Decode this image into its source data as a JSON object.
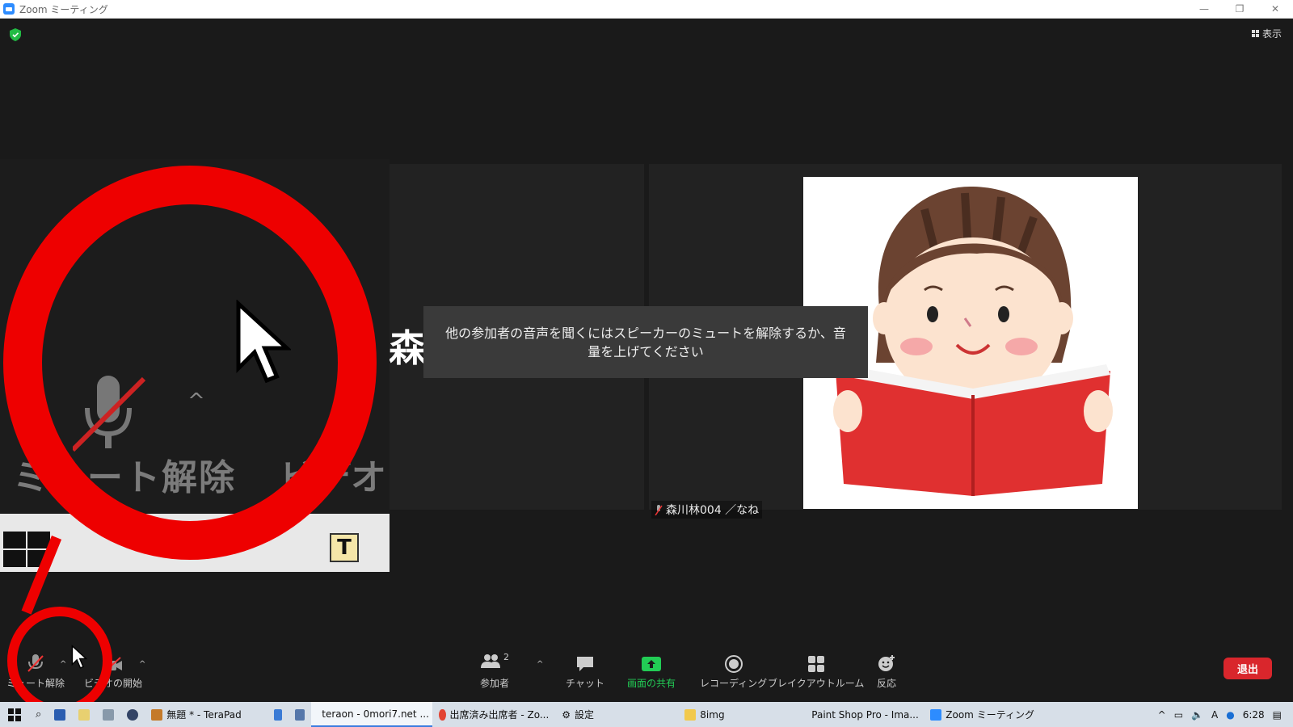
{
  "window": {
    "title": "Zoom ミーティング",
    "controls": [
      "—",
      "❐",
      "✕"
    ]
  },
  "meeting": {
    "view_label": "表示",
    "toast": "他の参加者の音声を聞くにはスピーカーのミュートを解除するか、音量を上げてください",
    "bg_text": "森の森",
    "participant_name": "森川林004 ／なね"
  },
  "zoom_inset": {
    "label_unmute": "ミュート解除",
    "label_video": "ビデオの",
    "t_icon": "T"
  },
  "toolbar": {
    "unmute": "ミュート解除",
    "start_video": "ビデオの開始",
    "participants": "参加者",
    "participants_count": "2",
    "chat": "チャット",
    "share": "画面の共有",
    "recording": "レコーディング",
    "breakout": "ブレイクアウトルーム",
    "reactions": "反応",
    "leave": "退出"
  },
  "taskbar": {
    "items": [
      {
        "label": "無題 * - TeraPad",
        "color": "#c47a2a",
        "active": false
      },
      {
        "label": "teraon - 0mori7.net ...",
        "color": "#884422",
        "active": true
      },
      {
        "label": "出席済み出席者 - Zo...",
        "color": "#e24433",
        "active": false
      },
      {
        "label": "設定",
        "color": "#555555",
        "active": false
      },
      {
        "label": "8img",
        "color": "#f2c94c",
        "active": false
      },
      {
        "label": "Paint Shop Pro - Ima...",
        "color": "#335599",
        "active": false
      },
      {
        "label": "Zoom ミーティング",
        "color": "#2d8cff",
        "active": false
      }
    ],
    "time": "6:28"
  },
  "colors": {
    "accent_red": "#ee0000",
    "leave": "#d9262c",
    "share_green": "#22cc55",
    "zoom_blue": "#2d8cff"
  }
}
